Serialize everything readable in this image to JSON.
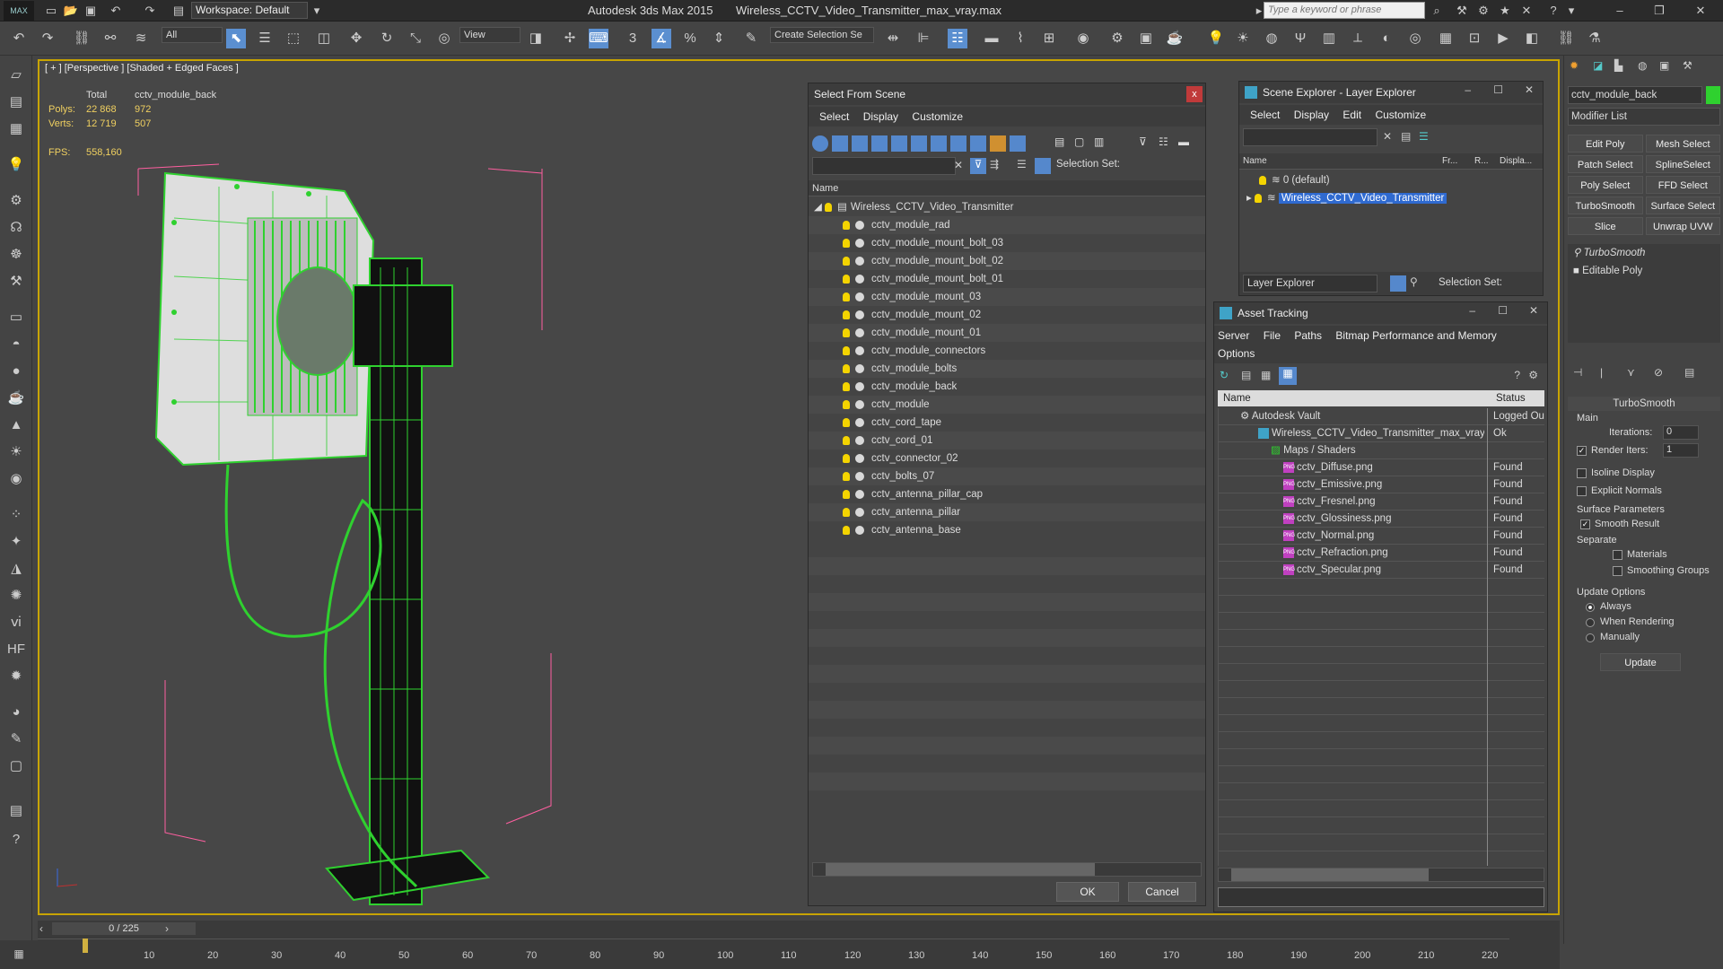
{
  "titlebar": {
    "logo": "MAX",
    "workspace": "Workspace: Default",
    "app": "Autodesk 3ds Max  2015",
    "file": "Wireless_CCTV_Video_Transmitter_max_vray.max",
    "search_placeholder": "Type a keyword or phrase"
  },
  "toolbar": {
    "filter": "All",
    "refcoord": "View",
    "selection_set": "Create Selection Se"
  },
  "viewport": {
    "label": "[ + ] [Perspective ] [Shaded + Edged Faces ]",
    "total_label": "Total",
    "object_name": "cctv_module_back",
    "polys_label": "Polys:",
    "polys_total": "22 868",
    "polys_sel": "972",
    "verts_label": "Verts:",
    "verts_total": "12 719",
    "verts_sel": "507",
    "fps_label": "FPS:",
    "fps_value": "558,160"
  },
  "select_from_scene": {
    "title": "Select From Scene",
    "menu": [
      "Select",
      "Display",
      "Customize"
    ],
    "selection_set_label": "Selection Set:",
    "column_name": "Name",
    "root": "Wireless_CCTV_Video_Transmitter",
    "items": [
      "cctv_module_rad",
      "cctv_module_mount_bolt_03",
      "cctv_module_mount_bolt_02",
      "cctv_module_mount_bolt_01",
      "cctv_module_mount_03",
      "cctv_module_mount_02",
      "cctv_module_mount_01",
      "cctv_module_connectors",
      "cctv_module_bolts",
      "cctv_module_back",
      "cctv_module",
      "cctv_cord_tape",
      "cctv_cord_01",
      "cctv_connector_02",
      "cctv_bolts_07",
      "cctv_antenna_pillar_cap",
      "cctv_antenna_pillar",
      "cctv_antenna_base"
    ],
    "ok": "OK",
    "cancel": "Cancel"
  },
  "scene_explorer": {
    "title": "Scene Explorer - Layer Explorer",
    "menu": [
      "Select",
      "Display",
      "Edit",
      "Customize"
    ],
    "columns": [
      "Name",
      "Fr...",
      "R...",
      "Displa..."
    ],
    "layers": [
      "0 (default)",
      "Wireless_CCTV_Video_Transmitter"
    ],
    "footer_mode": "Layer Explorer",
    "selection_set_label": "Selection Set:"
  },
  "asset_tracking": {
    "title": "Asset Tracking",
    "menu": [
      "Server",
      "File",
      "Paths",
      "Bitmap Performance and Memory"
    ],
    "menu2": "Options",
    "columns": [
      "Name",
      "Status"
    ],
    "rows": [
      {
        "name": "Autodesk Vault",
        "status": "Logged Ou"
      },
      {
        "name": "Wireless_CCTV_Video_Transmitter_max_vray...",
        "status": "Ok"
      },
      {
        "name": "Maps / Shaders",
        "status": ""
      },
      {
        "name": "cctv_Diffuse.png",
        "status": "Found"
      },
      {
        "name": "cctv_Emissive.png",
        "status": "Found"
      },
      {
        "name": "cctv_Fresnel.png",
        "status": "Found"
      },
      {
        "name": "cctv_Glossiness.png",
        "status": "Found"
      },
      {
        "name": "cctv_Normal.png",
        "status": "Found"
      },
      {
        "name": "cctv_Refraction.png",
        "status": "Found"
      },
      {
        "name": "cctv_Specular.png",
        "status": "Found"
      }
    ]
  },
  "command_panel": {
    "object_name": "cctv_module_back",
    "modifier_list": "Modifier List",
    "buttons": [
      "Edit Poly",
      "Mesh Select",
      "Patch Select",
      "SplineSelect",
      "Poly Select",
      "FFD Select",
      "TurboSmooth",
      "Surface Select",
      "Slice",
      "Unwrap UVW"
    ],
    "stack": [
      "TurboSmooth",
      "Editable Poly"
    ],
    "rollout": "TurboSmooth",
    "main": "Main",
    "iterations_label": "Iterations:",
    "iterations": "0",
    "render_iters_label": "Render Iters:",
    "render_iters": "1",
    "isoline": "Isoline Display",
    "explicit": "Explicit Normals",
    "surface_params": "Surface Parameters",
    "smooth_result": "Smooth Result",
    "separate": "Separate",
    "materials": "Materials",
    "smoothing_groups": "Smoothing Groups",
    "update_options": "Update Options",
    "always": "Always",
    "when_rendering": "When Rendering",
    "manually": "Manually",
    "update": "Update"
  },
  "timeline": {
    "frame": "0 / 225",
    "ticks": [
      "10",
      "20",
      "30",
      "40",
      "50",
      "60",
      "70",
      "80",
      "90",
      "100",
      "110",
      "120",
      "130",
      "140",
      "150",
      "160",
      "170",
      "180",
      "190",
      "200",
      "210",
      "220"
    ]
  }
}
